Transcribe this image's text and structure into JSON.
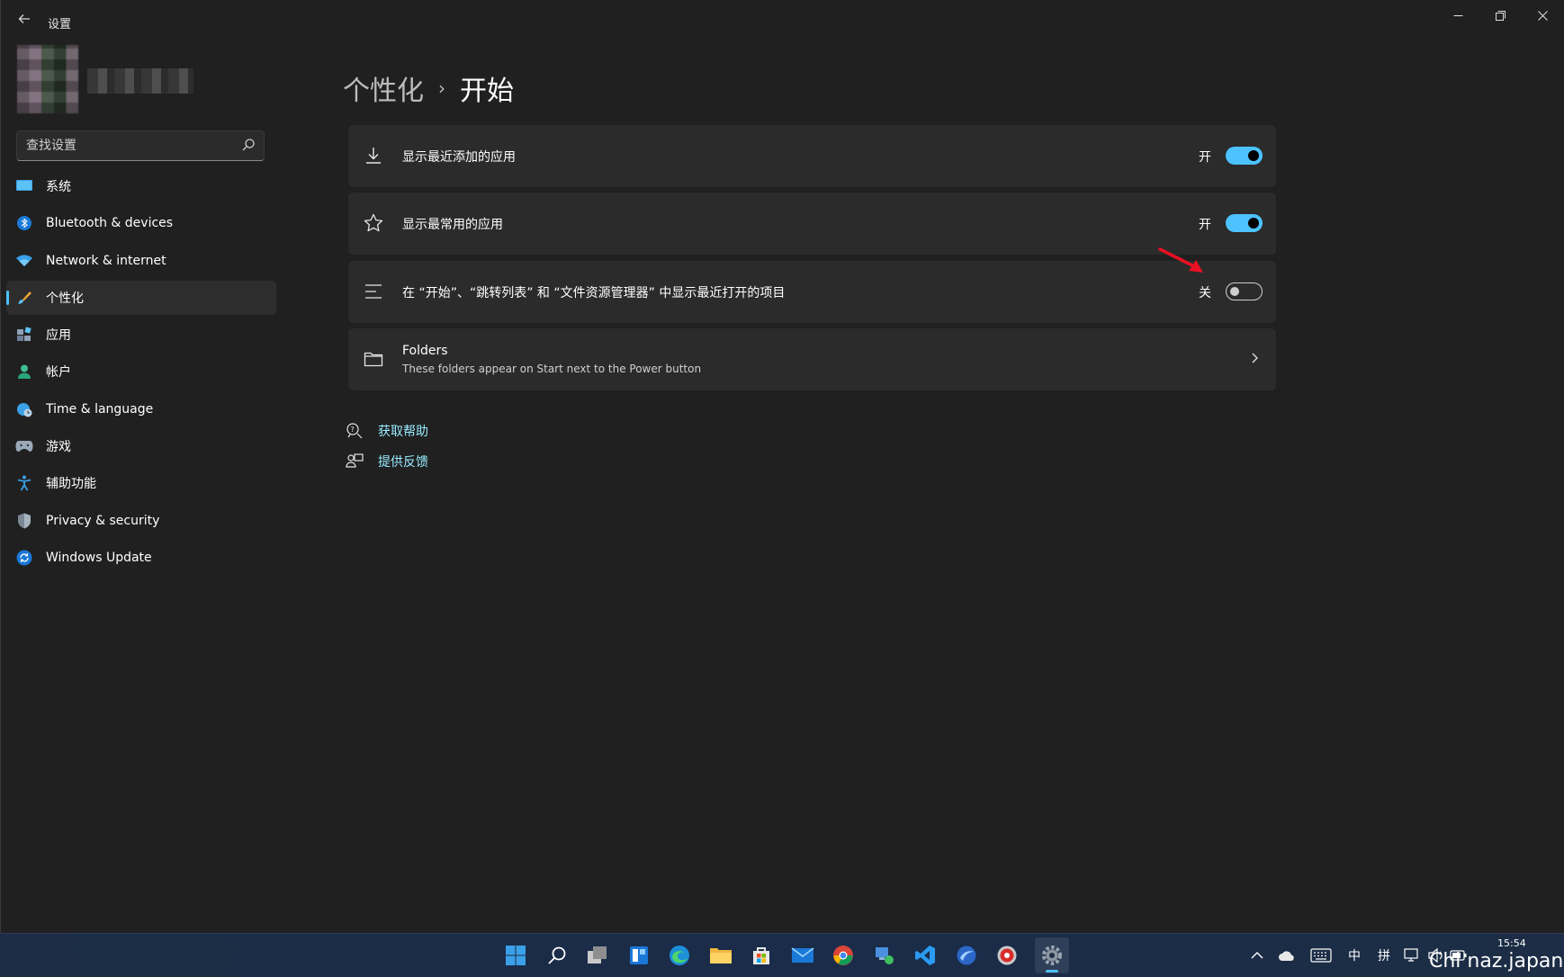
{
  "window": {
    "app_title": "设置",
    "controls": {
      "minimize": "—",
      "maximize": "❐",
      "close": "✕"
    }
  },
  "sidebar": {
    "search_placeholder": "查找设置",
    "items": [
      {
        "label": "系统",
        "icon": "monitor-icon"
      },
      {
        "label": "Bluetooth & devices",
        "icon": "bluetooth-icon"
      },
      {
        "label": "Network & internet",
        "icon": "wifi-icon"
      },
      {
        "label": "个性化",
        "icon": "brush-icon",
        "active": true
      },
      {
        "label": "应用",
        "icon": "apps-icon"
      },
      {
        "label": "帐户",
        "icon": "person-icon"
      },
      {
        "label": "Time & language",
        "icon": "globe-clock-icon"
      },
      {
        "label": "游戏",
        "icon": "gamepad-icon"
      },
      {
        "label": "辅助功能",
        "icon": "accessibility-icon"
      },
      {
        "label": "Privacy & security",
        "icon": "shield-icon"
      },
      {
        "label": "Windows Update",
        "icon": "update-icon"
      }
    ]
  },
  "breadcrumb": {
    "parent": "个性化",
    "separator": "›",
    "current": "开始"
  },
  "settings": [
    {
      "label": "显示最近添加的应用",
      "state_text": "开",
      "on": true,
      "icon": "download-icon"
    },
    {
      "label": "显示最常用的应用",
      "state_text": "开",
      "on": true,
      "icon": "star-icon"
    },
    {
      "label": "在 “开始”、“跳转列表” 和 “文件资源管理器” 中显示最近打开的项目",
      "state_text": "关",
      "on": false,
      "icon": "list-icon"
    },
    {
      "title": "Folders",
      "subtitle": "These folders appear on Start next to the Power button",
      "icon": "folder-icon"
    }
  ],
  "links": {
    "help": "获取帮助",
    "feedback": "提供反馈"
  },
  "tray": {
    "ime_lang": "中",
    "ime_mode": "拼",
    "clock_time": "15:54"
  },
  "watermark": "Chi naz.japan",
  "colors": {
    "accent": "#4cc2ff",
    "link": "#99ebff",
    "background": "#202020",
    "card": "#2b2b2b",
    "annotation": "#e81123"
  }
}
